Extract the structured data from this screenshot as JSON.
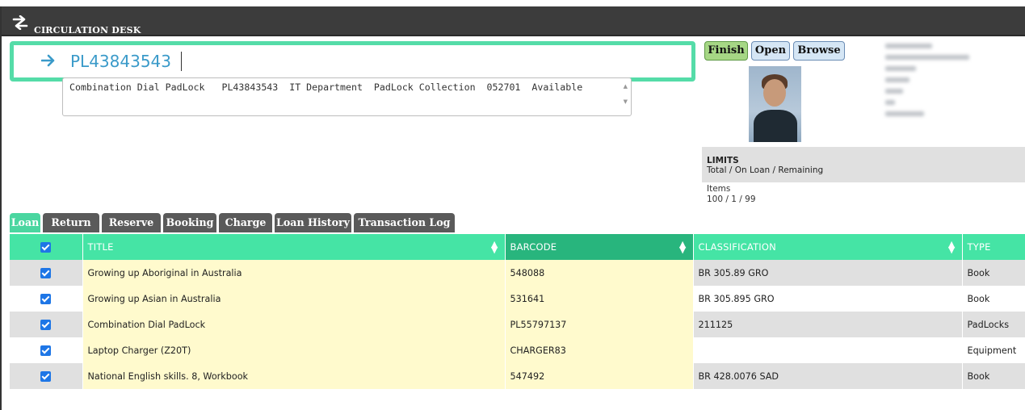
{
  "app": {
    "title": "CIRCULATION DESK"
  },
  "scan": {
    "value": "PL43843543"
  },
  "suggestion": {
    "text": "Combination Dial PadLock   PL43843543  IT Department  PadLock Collection  052701  Available"
  },
  "actions": {
    "finish": "Finish",
    "open": "Open",
    "browse": "Browse"
  },
  "limits": {
    "heading": "LIMITS",
    "subheading": "Total / On Loan / Remaining",
    "items_label": "Items",
    "items_value": "100 / 1 / 99"
  },
  "tabs": [
    {
      "label": "Loan",
      "active": true
    },
    {
      "label": "Return"
    },
    {
      "label": "Reserve"
    },
    {
      "label": "Booking"
    },
    {
      "label": "Charge"
    },
    {
      "label": "Loan History"
    },
    {
      "label": "Transaction Log"
    }
  ],
  "table": {
    "columns": {
      "title": "TITLE",
      "barcode": "BARCODE",
      "classification": "CLASSIFICATION",
      "type": "TYPE"
    },
    "rows": [
      {
        "title": "Growing up Aboriginal in Australia",
        "barcode": "548088",
        "classification": "BR 305.89 GRO",
        "type": "Book"
      },
      {
        "title": "Growing up Asian in Australia",
        "barcode": "531641",
        "classification": "BR 305.895 GRO",
        "type": "Book"
      },
      {
        "title": "Combination Dial PadLock",
        "barcode": "PL55797137",
        "classification": "211125",
        "type": "PadLocks"
      },
      {
        "title": "Laptop Charger (Z20T)",
        "barcode": "CHARGER83",
        "classification": "",
        "type": "Equipment"
      },
      {
        "title": "National English skills. 8, Workbook",
        "barcode": "547492",
        "classification": "BR 428.0076 SAD",
        "type": "Book"
      }
    ]
  },
  "icons": {
    "title_icon": "swap-arrows-icon",
    "scan_icon": "arrow-right-icon",
    "sort_icon": "sort-icon",
    "checkbox_icon": "checkbox-checked-icon"
  },
  "colors": {
    "accent": "#45e4a5",
    "sorted_header": "#28b57d",
    "title_bar": "#3c3c3c",
    "highlight_cell": "#fffacd",
    "finish_button": "#a6d785",
    "scan_text": "#3a9ac9"
  }
}
